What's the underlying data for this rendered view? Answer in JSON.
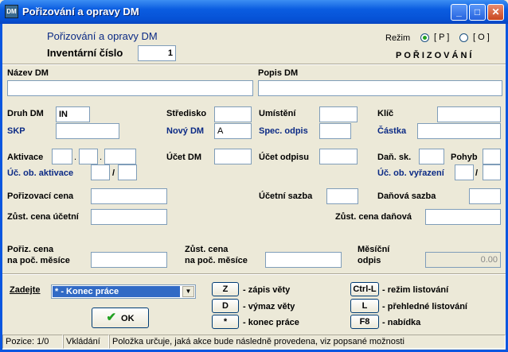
{
  "window": {
    "title": "Pořizování a opravy DM",
    "icon": "app-icon"
  },
  "header": {
    "title": "Pořizování a opravy DM",
    "inv_label": "Inventární číslo",
    "inv_value": "1",
    "mode_label": "Režim",
    "mode_p": "[ P ]",
    "mode_o": "[ O ]",
    "mode_text": "POŘIZOVÁNÍ"
  },
  "labels": {
    "nazev": "Název DM",
    "popis": "Popis DM",
    "druh": "Druh DM",
    "stredisko": "Středisko",
    "umisteni": "Umístění",
    "klic": "Klíč",
    "skp": "SKP",
    "novy_dm": "Nový DM",
    "spec": "Spec. odpis",
    "castka": "Částka",
    "aktivace": "Aktivace",
    "ucet_dm": "Účet DM",
    "ucet_odpisu": "Účet odpisu",
    "dan_sk": "Daň. sk.",
    "pohyb": "Pohyb",
    "uc_ob_akt": "Úč. ob. aktivace",
    "uc_ob_vyr": "Úč. ob. vyřazení",
    "por_cena": "Pořizovací cena",
    "uc_sazba": "Účetní sazba",
    "dan_sazba": "Daňová sazba",
    "zust_uc": "Zůst. cena účetní",
    "zust_dan": "Zůst. cena daňová",
    "poriz_mes_1": "Pořiz. cena",
    "poriz_mes_2": "na poč. měsíce",
    "zust_mes_1": "Zůst. cena",
    "zust_mes_2": "na poč. měsíce",
    "mes_odpis_1": "Měsíční",
    "mes_odpis_2": "odpis",
    "slash": "/",
    "dot": "."
  },
  "values": {
    "druh": "IN",
    "novy_dm": "A",
    "mes_odpis": "0.00"
  },
  "action": {
    "label": "Zadejte",
    "selected": "* - Konec práce",
    "ok": "OK"
  },
  "shortcuts": [
    {
      "key": "Z",
      "text": "- zápis věty"
    },
    {
      "key": "D",
      "text": "- výmaz věty"
    },
    {
      "key": "*",
      "text": "- konec práce"
    },
    {
      "key": "Ctrl-L",
      "text": "- režim listování"
    },
    {
      "key": "L",
      "text": "- přehledné listování"
    },
    {
      "key": "F8",
      "text": "- nabídka"
    }
  ],
  "status": {
    "pos": "Pozice: 1/0",
    "mode": "Vkládání",
    "hint": "Položka určuje, jaká akce bude následně provedena, viz popsané možnosti"
  }
}
